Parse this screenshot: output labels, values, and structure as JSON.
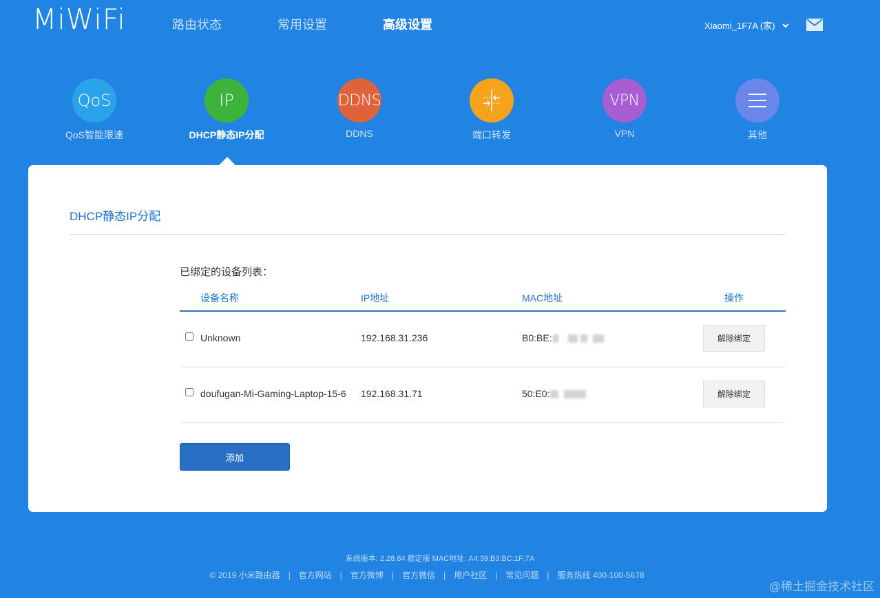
{
  "header": {
    "logo": "MiWiFi",
    "nav": [
      "路由状态",
      "常用设置",
      "高级设置"
    ],
    "active_nav": "高级设置",
    "router_name": "Xiaomi_1F7A (家)"
  },
  "features": [
    {
      "icon_text": "QoS",
      "label": "QoS智能限速",
      "color": "#2aa3ea",
      "icon": "qos-icon"
    },
    {
      "icon_text": "IP",
      "label": "DHCP静态IP分配",
      "color": "#3db33c",
      "icon": "ip-icon"
    },
    {
      "icon_text": "DDNS",
      "label": "DDNS",
      "color": "#e0623a",
      "icon": "ddns-icon"
    },
    {
      "icon_text": "",
      "label": "端口转发",
      "color": "#f5a31d",
      "icon": "port-forward-icon"
    },
    {
      "icon_text": "VPN",
      "label": "VPN",
      "color": "#a85ed3",
      "icon": "vpn-icon"
    },
    {
      "icon_text": "",
      "label": "其他",
      "color": "#6b86ea",
      "icon": "menu-icon"
    }
  ],
  "active_feature": "DHCP静态IP分配",
  "panel": {
    "title": "DHCP静态IP分配",
    "list_title": "已绑定的设备列表：",
    "columns": [
      "设备名称",
      "IP地址",
      "MAC地址",
      "操作"
    ],
    "rows": [
      {
        "name": "Unknown",
        "ip": "192.168.31.236",
        "mac": "B0:BE:",
        "action": "解除绑定"
      },
      {
        "name": "doufugan-Mi-Gaming-Laptop-15-6",
        "ip": "192.168.31.71",
        "mac": "50:E0:",
        "action": "解除绑定"
      }
    ],
    "add_label": "添加"
  },
  "footer": {
    "version": "系统版本: 2.28.84 稳定版  MAC地址: A4:39:B3:BC:1F:7A",
    "links": [
      "© 2019 小米路由器",
      "官方网站",
      "官方微博",
      "官方微信",
      "用户社区",
      "常见问题",
      "服务热线 400-100-5678"
    ]
  },
  "watermark": "@稀土掘金技术社区"
}
